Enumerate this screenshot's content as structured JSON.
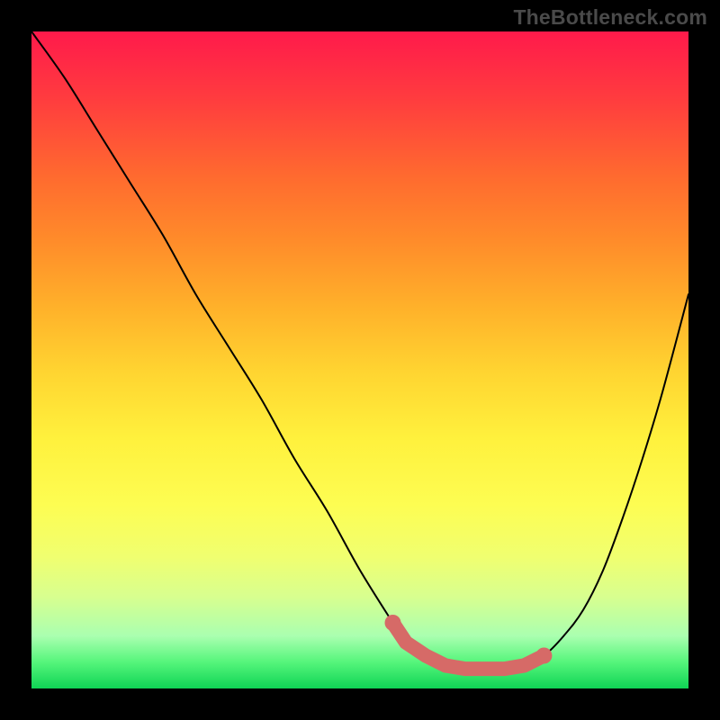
{
  "watermark": "TheBottleneck.com",
  "colors": {
    "curve": "#000000",
    "marker": "#d66a67",
    "gradient_top": "#ff1a4b",
    "gradient_bottom": "#0fd455",
    "frame": "#000000"
  },
  "chart_data": {
    "type": "line",
    "title": "",
    "xlabel": "",
    "ylabel": "",
    "xlim": [
      0,
      100
    ],
    "ylim": [
      0,
      100
    ],
    "grid": false,
    "legend": false,
    "x": [
      0,
      5,
      10,
      15,
      20,
      25,
      30,
      35,
      40,
      45,
      50,
      55,
      57,
      60,
      63,
      66,
      69,
      72,
      75,
      78,
      81,
      84,
      87,
      90,
      93,
      96,
      100
    ],
    "values": [
      100,
      93,
      85,
      77,
      69,
      60,
      52,
      44,
      35,
      27,
      18,
      10,
      7,
      5,
      3.5,
      3,
      3,
      3,
      3.5,
      5,
      8,
      12,
      18,
      26,
      35,
      45,
      60
    ],
    "marker_region": {
      "x_start": 55,
      "x_end": 80,
      "y": 4
    }
  }
}
